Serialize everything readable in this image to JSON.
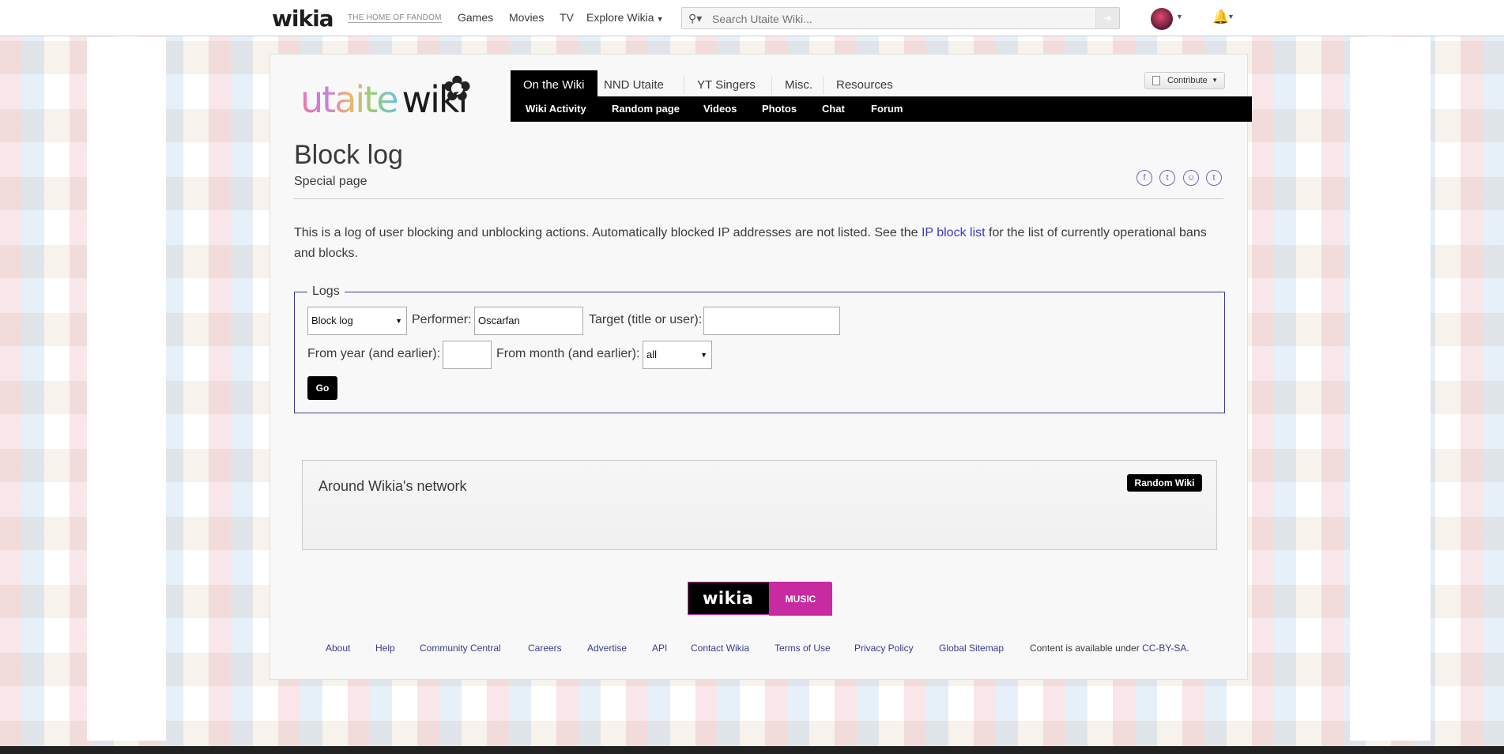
{
  "global_nav": {
    "logo": "wikia",
    "tagline": "THE HOME OF FANDOM",
    "links": [
      "Games",
      "Movies",
      "TV",
      "Explore Wikia"
    ],
    "search_placeholder": "Search Utaite Wiki..."
  },
  "wiki": {
    "logo_text": "utaite",
    "logo_wiki": "wiki",
    "tabs": [
      "On the Wiki",
      "NND Utaite",
      "YT Singers",
      "Misc.",
      "Resources"
    ],
    "subnav": [
      "Wiki Activity",
      "Random page",
      "Videos",
      "Photos",
      "Chat",
      "Forum"
    ],
    "contribute_label": "Contribute"
  },
  "page": {
    "title": "Block log",
    "subtitle": "Special page",
    "intro_before": "This is a log of user blocking and unblocking actions. Automatically blocked IP addresses are not listed. See the ",
    "intro_link": "IP block list",
    "intro_after": " for the list of currently operational bans and blocks."
  },
  "form": {
    "legend": "Logs",
    "log_type": "Block log",
    "performer_label": "Performer:",
    "performer_value": "Oscarfan",
    "target_label": "Target (title or user):",
    "target_value": "",
    "year_label": "From year (and earlier):",
    "year_value": "",
    "month_label": "From month (and earlier):",
    "month_value": "all",
    "go_label": "Go"
  },
  "network": {
    "title": "Around Wikia's network",
    "random_label": "Random Wiki"
  },
  "brand": {
    "wikia": "wikia",
    "music": "MUSIC"
  },
  "footer": {
    "links": [
      "About",
      "Help",
      "Community Central",
      "Careers",
      "Advertise",
      "API",
      "Contact Wikia",
      "Terms of Use",
      "Privacy Policy",
      "Global Sitemap"
    ],
    "license_text": "Content is available under ",
    "license_link": "CC-BY-SA."
  },
  "colors": {
    "accent": "#3a3ac0",
    "brand_music": "#c82aa2"
  },
  "icons": [
    "search-icon",
    "bell-icon",
    "facebook-icon",
    "twitter-icon",
    "reddit-icon",
    "tumblr-icon",
    "butterfly-icon"
  ]
}
